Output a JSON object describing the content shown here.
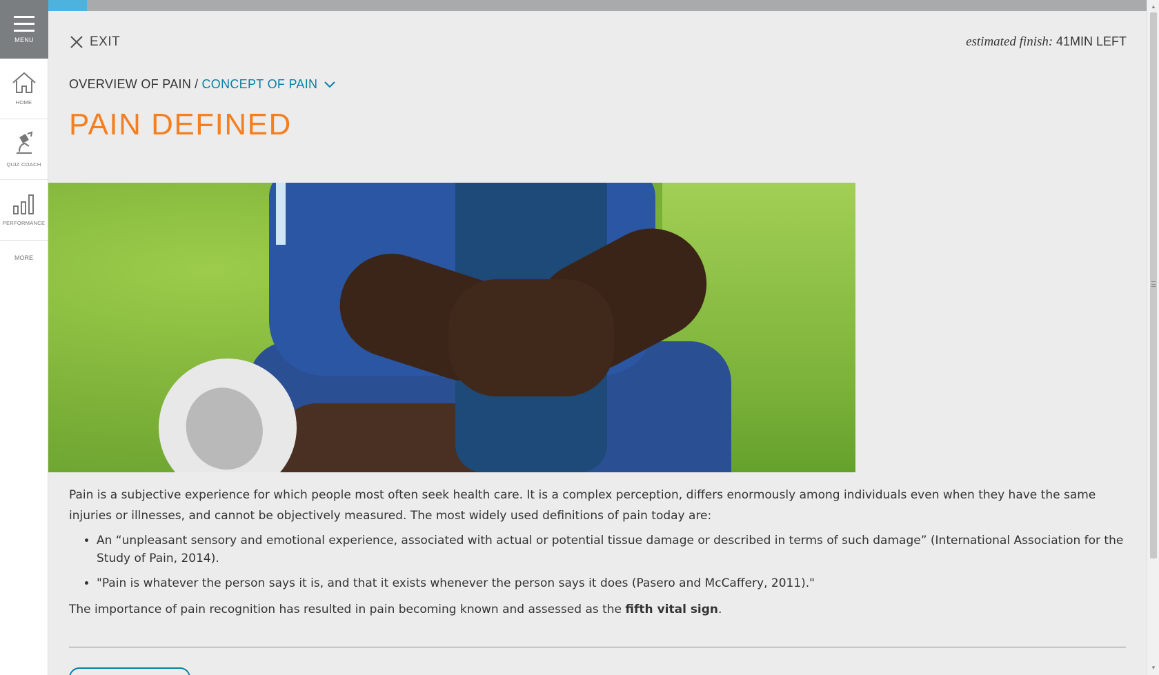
{
  "sidebar": {
    "menu_label": "MENU",
    "items": [
      {
        "label": "HOME",
        "icon": "home-icon"
      },
      {
        "label": "QUIZ COACH",
        "icon": "quiz-coach-icon"
      },
      {
        "label": "PERFORMANCE",
        "icon": "bar-chart-icon"
      }
    ],
    "more_label": "MORE"
  },
  "progress": {
    "fraction": 0.035
  },
  "header": {
    "exit_label": "EXIT",
    "estimate_label": "estimated finish:",
    "estimate_value": "41MIN LEFT"
  },
  "breadcrumb": {
    "parent": "OVERVIEW OF PAIN",
    "separator": "/",
    "current": "CONCEPT OF PAIN"
  },
  "title": "PAIN DEFINED",
  "content": {
    "intro": "Pain is a subjective experience for which people most often seek health care. It is a complex perception, differs enormously among individuals even when they have the same injuries or illnesses, and cannot be objectively measured. The most widely used definitions of pain today are:",
    "bullets": [
      "An “unpleasant sensory and emotional experience, associated with actual or potential tissue damage or described in terms of such damage” (International Association for the Study of Pain, 2014).",
      "\"Pain is whatever the person says it is, and that it exists whenever the person says it does (Pasero and McCaffery, 2011).\""
    ],
    "closing_prefix": "The importance of pain recognition has resulted in pain becoming known and assessed as the ",
    "closing_strong": "fifth vital sign",
    "closing_suffix": "."
  },
  "colors": {
    "accent": "#f47f20",
    "link": "#0a7ea5",
    "progress": "#4db2de",
    "menu_bg": "#7b7e80"
  }
}
